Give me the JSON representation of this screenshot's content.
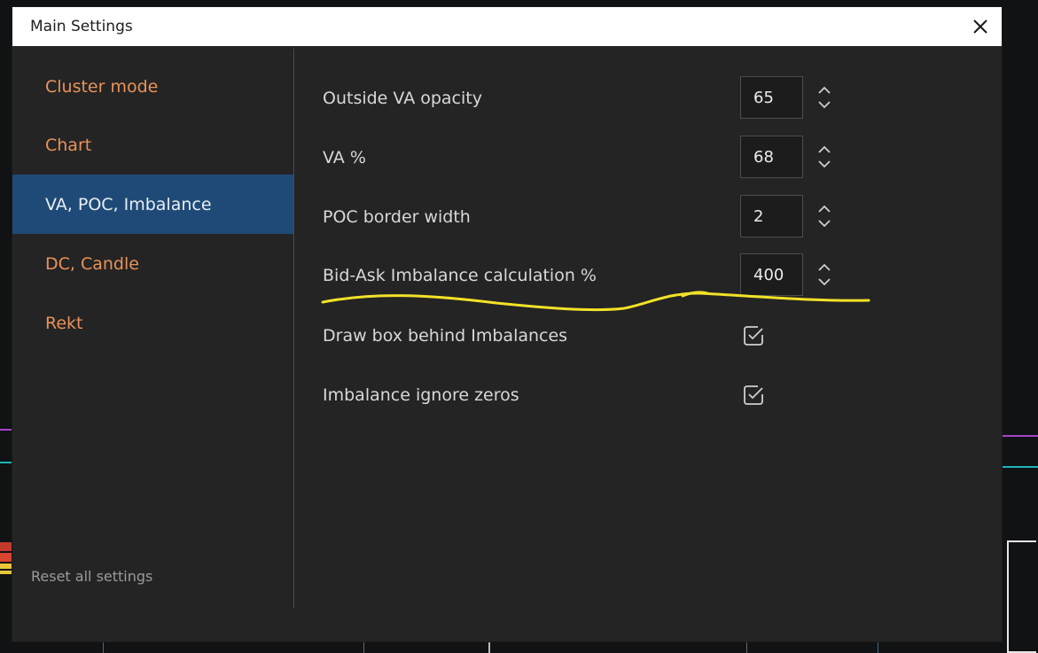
{
  "window": {
    "title": "Main Settings",
    "close_icon": "close-icon"
  },
  "sidebar": {
    "items": [
      {
        "label": "Cluster mode",
        "active": false
      },
      {
        "label": "Chart",
        "active": false
      },
      {
        "label": "VA, POC, Imbalance",
        "active": true
      },
      {
        "label": "DC, Candle",
        "active": false
      },
      {
        "label": "Rekt",
        "active": false
      }
    ],
    "reset_label": "Reset all settings"
  },
  "settings": {
    "outside_va_opacity": {
      "label": "Outside VA opacity",
      "value": "65"
    },
    "va_percent": {
      "label": "VA %",
      "value": "68"
    },
    "poc_border_width": {
      "label": "POC border width",
      "value": "2"
    },
    "imbalance_calc": {
      "label": "Bid-Ask Imbalance calculation %",
      "value": "400"
    },
    "draw_box": {
      "label": "Draw box behind Imbalances",
      "checked": true
    },
    "ignore_zeros": {
      "label": "Imbalance ignore zeros",
      "checked": true
    }
  },
  "colors": {
    "accent_orange": "#e8935a",
    "active_bg": "#1f4a77",
    "dialog_bg": "#242424",
    "highlight_yellow": "#f2e227"
  }
}
